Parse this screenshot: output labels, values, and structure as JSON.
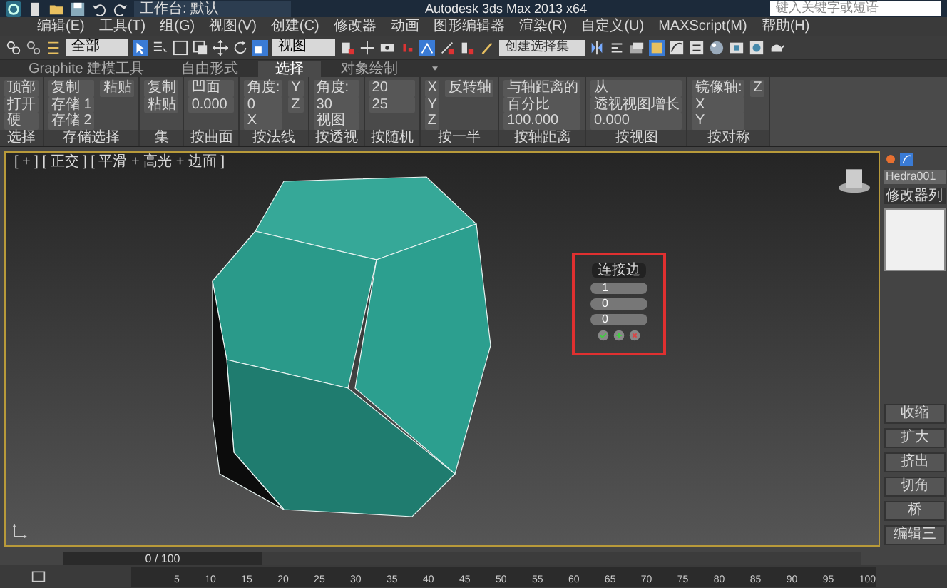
{
  "title_bar": {
    "workspace": "工作台: 默认",
    "app_title": "Autodesk 3ds Max 2013 x64",
    "search_placeholder": "键入关键字或短语"
  },
  "menu": [
    "编辑(E)",
    "工具(T)",
    "组(G)",
    "视图(V)",
    "创建(C)",
    "修改器",
    "动画",
    "图形编辑器",
    "渲染(R)",
    "自定义(U)",
    "MAXScript(M)",
    "帮助(H)"
  ],
  "toolbar": {
    "selection_filter": "全部",
    "coordinate_system": "视图",
    "named_selection_placeholder": "创建选择集"
  },
  "ribbon_tabs": [
    {
      "label": "Graphite 建模工具",
      "selected": false
    },
    {
      "label": "自由形式",
      "selected": false
    },
    {
      "label": "选择",
      "selected": true
    },
    {
      "label": "对象绘制",
      "selected": false
    }
  ],
  "ribbon_panels": [
    {
      "title": "选择",
      "items": [
        "顶部",
        "打开",
        "硬"
      ]
    },
    {
      "title": "存储选择",
      "items": [
        "复制",
        "存储 1",
        "存储 2",
        "粘贴"
      ]
    },
    {
      "title": "集",
      "items": [
        "复制",
        "粘贴"
      ]
    },
    {
      "title": "按曲面",
      "items": [
        "凹面",
        "0.000"
      ]
    },
    {
      "title": "按法线",
      "items": [
        "角度:",
        "0",
        "X",
        "Y",
        "Z"
      ]
    },
    {
      "title": "按透视",
      "items": [
        "角度:",
        "30",
        "视图"
      ]
    },
    {
      "title": "按随机",
      "items": [
        "20",
        "25"
      ]
    },
    {
      "title": "按一半",
      "items": [
        "X",
        "Y",
        "Z",
        "反转轴"
      ]
    },
    {
      "title": "按轴距离",
      "items": [
        "与轴距离的",
        "百分比",
        "100.000"
      ]
    },
    {
      "title": "按视图",
      "items": [
        "从",
        "透视视图增长",
        "0.000"
      ]
    },
    {
      "title": "按对称",
      "items": [
        "镜像轴:",
        "X",
        "Y",
        "Z"
      ]
    }
  ],
  "viewport": {
    "label": "[ + ] [ 正交 ] [ 平滑 + 高光 + 边面 ]",
    "caddy": {
      "title": "连接边",
      "fields": [
        "1",
        "0",
        "0"
      ]
    }
  },
  "command_panel": {
    "object_name": "Hedra001",
    "modifier_list": "修改器列",
    "buttons": [
      "收缩",
      "扩大",
      "挤出",
      "切角",
      "桥",
      "编辑三"
    ]
  },
  "timeline": {
    "slider": {
      "label": "0 / 100",
      "level": 0
    },
    "ticks": [
      "5",
      "10",
      "15",
      "20",
      "25",
      "30",
      "35",
      "40",
      "45",
      "50",
      "55",
      "60",
      "65",
      "70",
      "75",
      "80",
      "85",
      "90",
      "95",
      "100"
    ]
  }
}
